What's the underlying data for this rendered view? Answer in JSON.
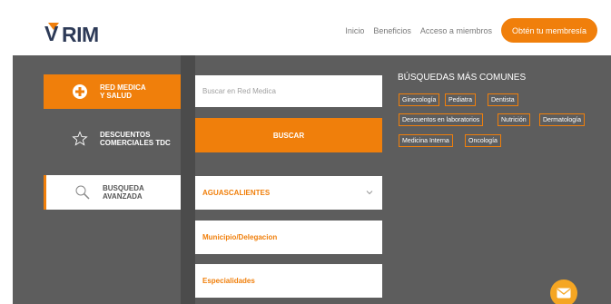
{
  "logo": {
    "text": "VRIM"
  },
  "nav": {
    "links": [
      "Inicio",
      "Beneficios",
      "Acceso a miembros"
    ],
    "cta": "Obtén tu membresía"
  },
  "sidebar": {
    "items": [
      {
        "label": "RED MEDICA\nY SALUD",
        "icon": "plus-circle-icon",
        "active": true
      },
      {
        "label": "DESCUENTOS\nCOMERCIALES TDC",
        "icon": "star-icon",
        "active": false
      },
      {
        "label": "BUSQUEDA\nAVANZADA",
        "icon": "magnifier-icon",
        "active": false
      }
    ]
  },
  "search": {
    "placeholder": "Buscar en Red Medica",
    "button": "BUSCAR"
  },
  "filters": {
    "state": "AGUASCALIENTES",
    "municipality": "Municipio/Delegacion",
    "specialty": "Especialidades"
  },
  "common": {
    "title": "BÚSQUEDAS MÁS COMUNES",
    "tags": [
      "Ginecología",
      "Pediatra",
      "Dentista",
      "Descuentos en laboratorios",
      "Nutrición",
      "Dermatología",
      "Medicina Interna",
      "Oncología"
    ]
  },
  "colors": {
    "accent": "#f07f0b",
    "dark_bg": "#5d5d5d",
    "brand_text": "#2d3a57"
  }
}
